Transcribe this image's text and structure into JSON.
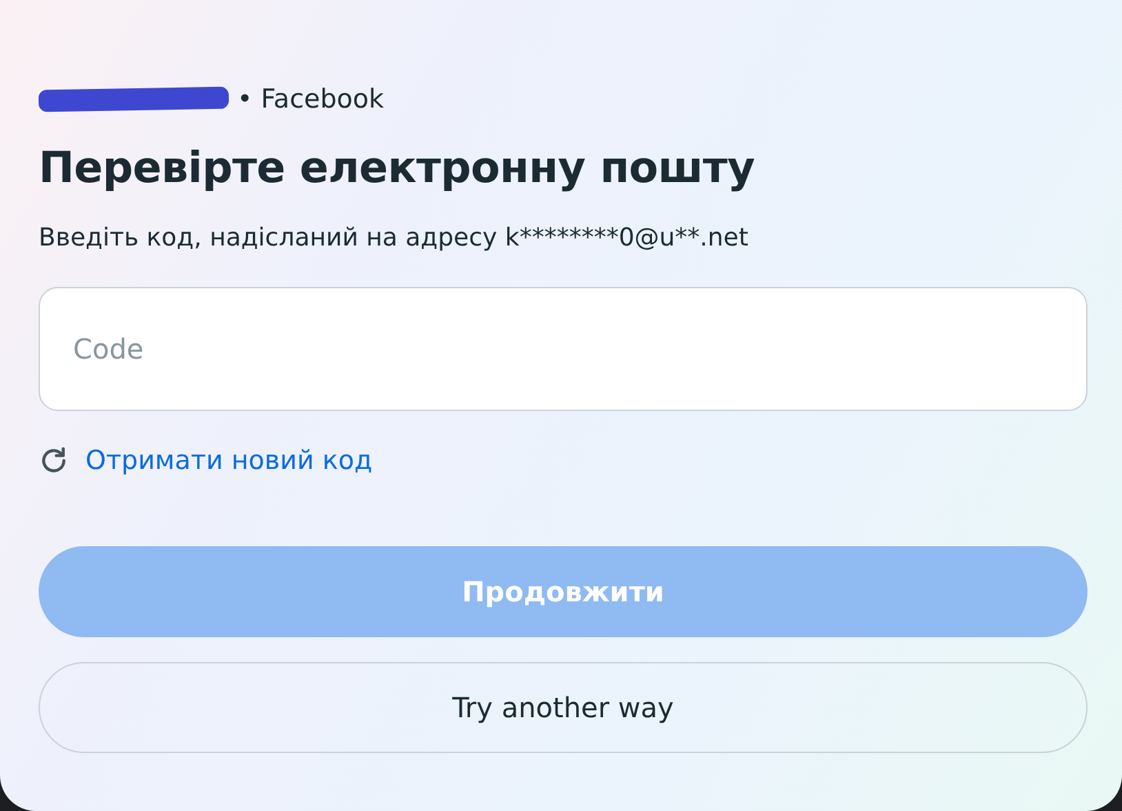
{
  "header": {
    "source": "• Facebook"
  },
  "title": "Перевірте електронну пошту",
  "description": "Введіть код, надісланий на адресу k********0@u**.net",
  "code_field": {
    "placeholder": "Code"
  },
  "resend_link": "Отримати новий код",
  "continue_button": {
    "label": "Продовжити",
    "disabled": true
  },
  "alternate_button": {
    "label": "Try another way"
  }
}
